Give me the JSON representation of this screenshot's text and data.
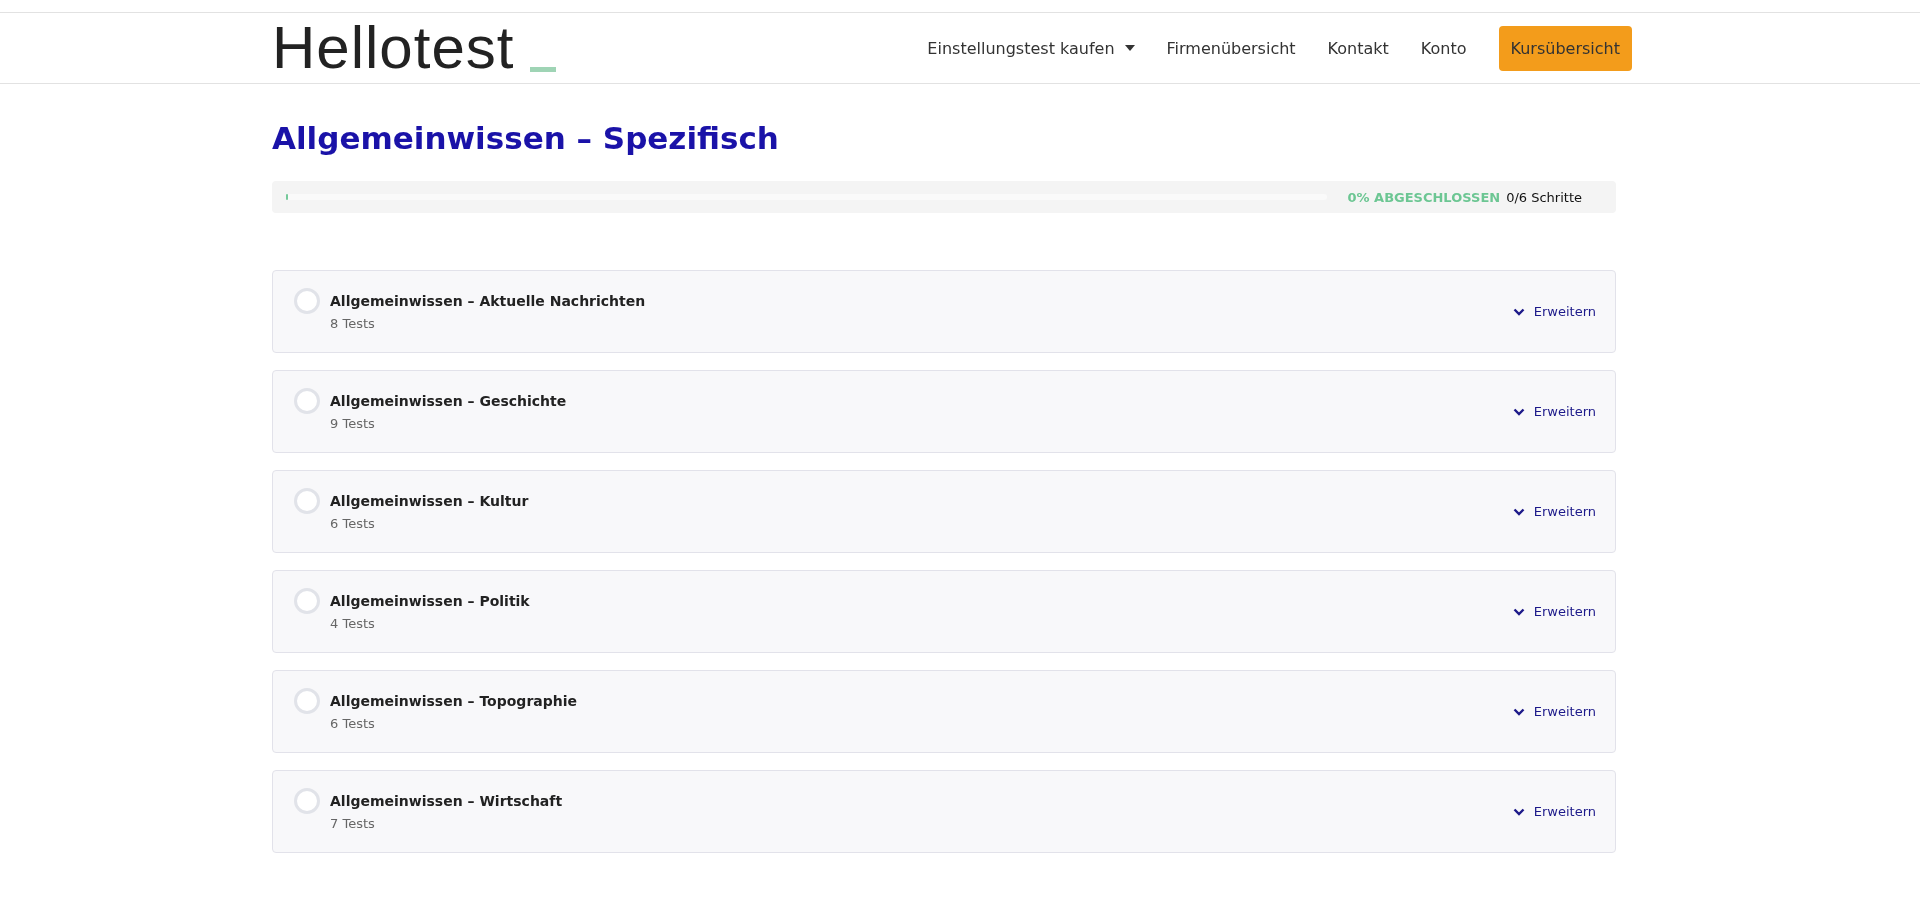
{
  "logo": {
    "text": "Hellotest"
  },
  "nav": [
    {
      "label": "Einstellungstest kaufen",
      "kind": "dropdown"
    },
    {
      "label": "Firmenübersicht",
      "kind": "link"
    },
    {
      "label": "Kontakt",
      "kind": "link"
    },
    {
      "label": "Konto",
      "kind": "link"
    },
    {
      "label": "Kursübersicht",
      "kind": "button"
    }
  ],
  "course": {
    "title": "Allgemeinwissen – Spezifisch"
  },
  "progress": {
    "level": 0,
    "percent": "0% ABGESCHLOSSEN",
    "steps": "0/6 Schritte"
  },
  "lessons": [
    {
      "title": "Allgemeinwissen – Aktuelle Nachrichten",
      "count": "8 Tests",
      "completed": false,
      "toggle": "Erweitern"
    },
    {
      "title": "Allgemeinwissen – Geschichte",
      "count": "9 Tests",
      "completed": false,
      "toggle": "Erweitern"
    },
    {
      "title": "Allgemeinwissen – Kultur",
      "count": "6 Tests",
      "completed": false,
      "toggle": "Erweitern"
    },
    {
      "title": "Allgemeinwissen – Politik",
      "count": "4 Tests",
      "completed": false,
      "toggle": "Erweitern"
    },
    {
      "title": "Allgemeinwissen – Topographie",
      "count": "6 Tests",
      "completed": false,
      "toggle": "Erweitern"
    },
    {
      "title": "Allgemeinwissen – Wirtschaft",
      "count": "7 Tests",
      "completed": false,
      "toggle": "Erweitern"
    }
  ]
}
